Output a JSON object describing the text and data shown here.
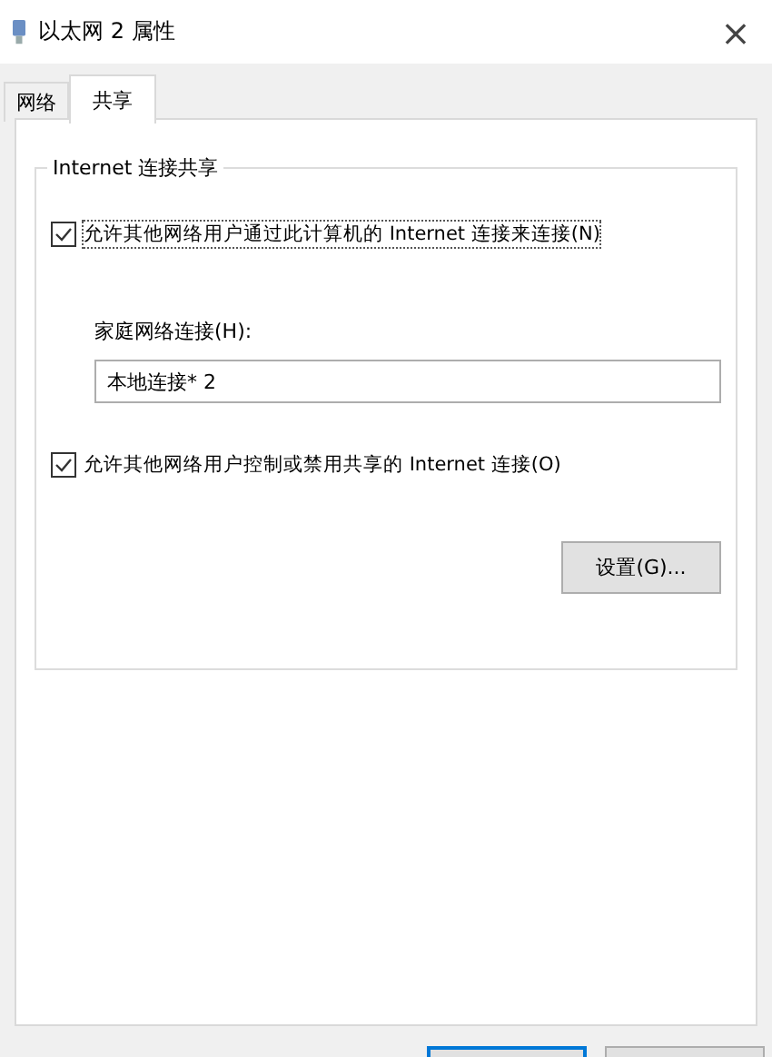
{
  "window": {
    "title": "以太网 2 属性",
    "close": "×"
  },
  "tabs": [
    {
      "label": "网络",
      "selected": false
    },
    {
      "label": "共享",
      "selected": true
    }
  ],
  "group": {
    "title": "Internet 连接共享",
    "options": [
      {
        "kind": "checkbox",
        "label": "允许其他网络用户通过此计算机的 Internet 连接来连接(N)",
        "checked": true,
        "focused": true
      },
      {
        "kind": "field",
        "label": "家庭网络连接(H):",
        "value": "本地连接* 2"
      },
      {
        "kind": "checkbox",
        "label": "允许其他网络用户控制或禁用共享的 Internet 连接(O)",
        "checked": true,
        "focused": false
      }
    ],
    "settings_button": "设置(G)..."
  },
  "footer_buttons": [
    {
      "default": true
    },
    {
      "default": false
    }
  ]
}
